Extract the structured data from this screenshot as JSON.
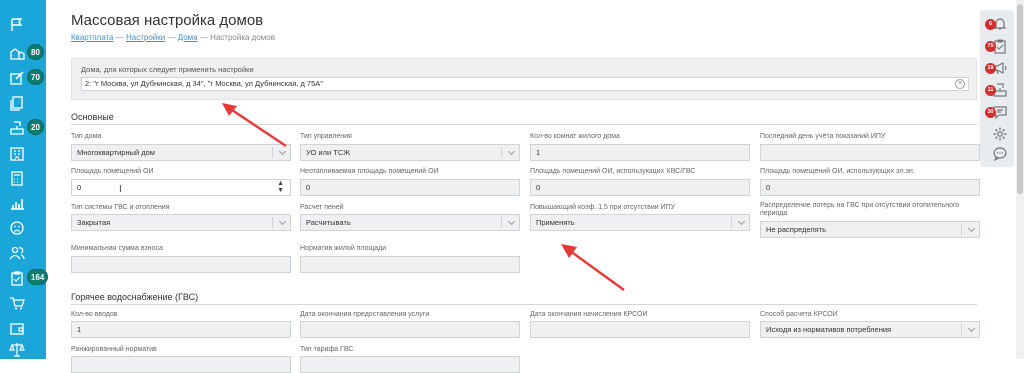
{
  "page": {
    "title": "Массовая настройка домов",
    "breadcrumb": [
      {
        "label": "Квартплата",
        "link": true
      },
      {
        "label": "Настройки",
        "link": true
      },
      {
        "label": "Дома",
        "link": true
      },
      {
        "label": "Настройка домов",
        "link": false
      }
    ],
    "breadcrumb_sep": "—"
  },
  "houses": {
    "label": "Дома, для которых следует применить настройки",
    "value": "2: \"г Москва, ул Дубнинская, д 34\", \"г Москва, ул Дубнинская, д 75А\"",
    "clear_icon": "×"
  },
  "sections": {
    "basic": "Основные",
    "hot_water": "Горячее водоснабжение (ГВС)"
  },
  "basic_fields": {
    "house_type": {
      "label": "Тип дома",
      "value": "Многоквартирный дом"
    },
    "management_type": {
      "label": "Тип управления",
      "value": "УО или ТСЖ"
    },
    "rooms_count": {
      "label": "Кол-во комнат жилого дома",
      "value": "1"
    },
    "last_day_ipu": {
      "label": "Последний день учёта показаний ИПУ",
      "value": ""
    },
    "oi_area": {
      "label": "Площадь помещений ОИ",
      "value": "0"
    },
    "nonresidential_oi_area": {
      "label": "Неотапливаемая площадь помещений ОИ",
      "value": "0"
    },
    "oi_area_water": {
      "label": "Площадь помещений ОИ, использующих ХВС/ГВС",
      "value": "0"
    },
    "oi_area_power": {
      "label": "Площадь помещений ОИ, использующих эл.эн.",
      "value": "0"
    },
    "gvs_system_type": {
      "label": "Тип системы ГВС и отопления",
      "value": "Закрытая"
    },
    "penalty_calc": {
      "label": "Расчет пеней",
      "value": "Расчитывать"
    },
    "coef_no_ipu": {
      "label": "Повышающий коэф. 1,5 при отсутствии ИПУ",
      "value": "Применять"
    },
    "loss_distribution": {
      "label": "Распределение потерь на ГВС при отсутствии отопительного периода",
      "value": "Не распределять"
    },
    "min_contribution": {
      "label": "Минимальная сумма взноса",
      "value": ""
    },
    "living_area_norm": {
      "label": "Норматив жилой площади",
      "value": ""
    }
  },
  "hot_water_fields": {
    "inputs_count": {
      "label": "Кол-во вводов",
      "value": "1"
    },
    "service_end_date": {
      "label": "Дата окончания предоставления услуги",
      "value": ""
    },
    "krsoi_end_date": {
      "label": "Дата окончания начисления КРСОИ",
      "value": ""
    },
    "krsoi_method": {
      "label": "Способ расчета КРСОИ",
      "value": "Исходя из нормативов потребления"
    },
    "ranked_norm": {
      "label": "Ранжированный норматив",
      "value": ""
    },
    "tariff_type": {
      "label": "Тип тарифа ГВС",
      "value": ""
    }
  },
  "sidebar": {
    "badges": {
      "houses": "80",
      "edit": "70",
      "meters": "20",
      "tasks": "164"
    }
  },
  "rightbar": {
    "badges": {
      "bell": "6",
      "clipboard": "75",
      "megaphone": "19",
      "building": "11",
      "chat": "30"
    }
  },
  "colors": {
    "sidebar": "#1aa6d9",
    "sidebar_badge": "#0e7c6f",
    "right_badge": "#d32f2f",
    "arrow": "#e53935",
    "field_bg": "#eef0f2"
  }
}
